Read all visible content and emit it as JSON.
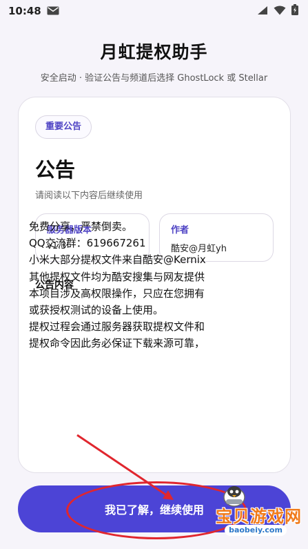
{
  "status_bar": {
    "time": "10:48"
  },
  "app": {
    "title": "月虹提权助手",
    "subtitle": "安全启动 · 验证公告与频道后选择 GhostLock 或 Stellar"
  },
  "card": {
    "badge": "重要公告",
    "title": "公告",
    "subtitle": "请阅读以下内容后继续使用",
    "server_version": {
      "label": "服务器版本",
      "value": "v1.3"
    },
    "author": {
      "label": "作者",
      "value": "酷安@月虹yh"
    },
    "content_title": "公告内容",
    "content_lines": [
      "免费分享，严禁倒卖。",
      "QQ交流群：619667261",
      "小米大部分提权文件来自酷安@Kernix",
      "其他提权文件均为酷安搜集与网友提供",
      "本项目涉及高权限操作，只应在您拥有",
      "或获授权测试的设备上使用。",
      "提权过程会通过服务器获取提权文件和",
      "提权命令因此务必保证下载来源可靠，"
    ]
  },
  "button": {
    "label": "我已了解，继续使用"
  },
  "watermark": {
    "text": "宝贝游戏网",
    "url": "baobeiy.com"
  },
  "colors": {
    "accent": "#4c44d6",
    "annotation": "#e0262e",
    "watermark": "#f07a1a"
  }
}
